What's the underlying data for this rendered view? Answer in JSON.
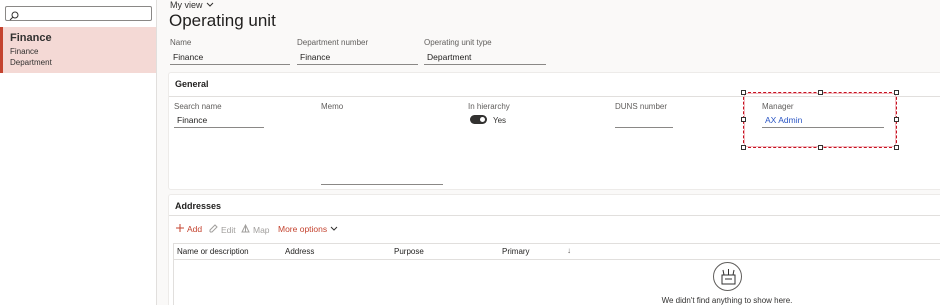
{
  "list": {
    "search_placeholder": "",
    "selected_item": {
      "title": "Finance",
      "line1": "Finance",
      "line2": "Department"
    }
  },
  "header": {
    "view_label": "My view",
    "title": "Operating unit"
  },
  "fields": {
    "name": {
      "label": "Name",
      "value": "Finance"
    },
    "department_number": {
      "label": "Department number",
      "value": "Finance"
    },
    "operating_unit_type": {
      "label": "Operating unit type",
      "value": "Department"
    }
  },
  "general": {
    "title": "General",
    "search_name": {
      "label": "Search name",
      "value": "Finance"
    },
    "memo": {
      "label": "Memo",
      "value": ""
    },
    "in_hierarchy": {
      "label": "In hierarchy",
      "value": "Yes",
      "on": true
    },
    "duns_number": {
      "label": "DUNS number",
      "value": ""
    },
    "manager": {
      "label": "Manager",
      "value": "AX Admin"
    }
  },
  "addresses": {
    "title": "Addresses",
    "toolbar": {
      "add": "Add",
      "edit": "Edit",
      "map": "Map",
      "more": "More options"
    },
    "columns": [
      "Name or description",
      "Address",
      "Purpose",
      "Primary"
    ],
    "sort_indicator": "↓",
    "empty_message": "We didn't find anything to show here."
  },
  "colors": {
    "accent": "#c4432f",
    "link": "#2b56c4",
    "selection": "#f4d9d5",
    "focus_border": "#c50f1f"
  },
  "icons": [
    "search-icon",
    "chevron-down-icon",
    "plus-icon",
    "pencil-icon",
    "map-icon",
    "empty-state-icon"
  ]
}
